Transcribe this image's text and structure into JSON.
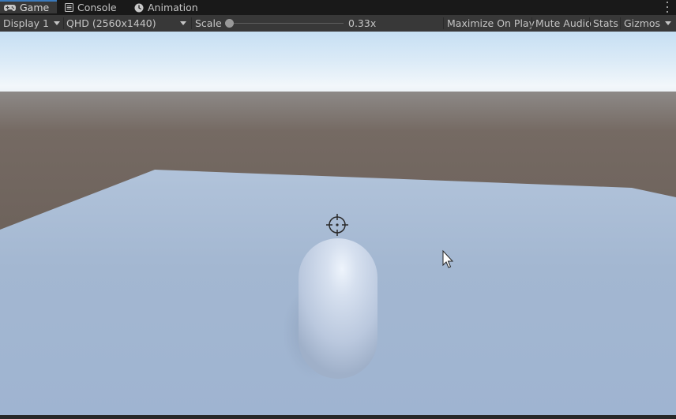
{
  "tabs": [
    {
      "label": "Game",
      "icon": "gamepad-icon",
      "active": true
    },
    {
      "label": "Console",
      "icon": "console-icon",
      "active": false
    },
    {
      "label": "Animation",
      "icon": "animation-icon",
      "active": false
    }
  ],
  "toolbar": {
    "display": "Display 1",
    "resolution": "QHD (2560x1440)",
    "scale_label": "Scale",
    "scale_value": "0.33x",
    "scale_fraction": 0.0,
    "maximize_on_play": "Maximize On Play",
    "mute_audio": "Mute Audio",
    "stats": "Stats",
    "gizmos": "Gizmos"
  },
  "scene": {
    "objects": [
      "ground-plane",
      "capsule",
      "crosshair"
    ],
    "colors": {
      "tab_active_accent": "#3a79bb",
      "sky_top": "#c9e3f6",
      "sky_horizon": "#f0f6fb",
      "ground_far": "#6b5e56",
      "plane": "#a5b9d3",
      "capsule": "#c7d3e6"
    }
  }
}
